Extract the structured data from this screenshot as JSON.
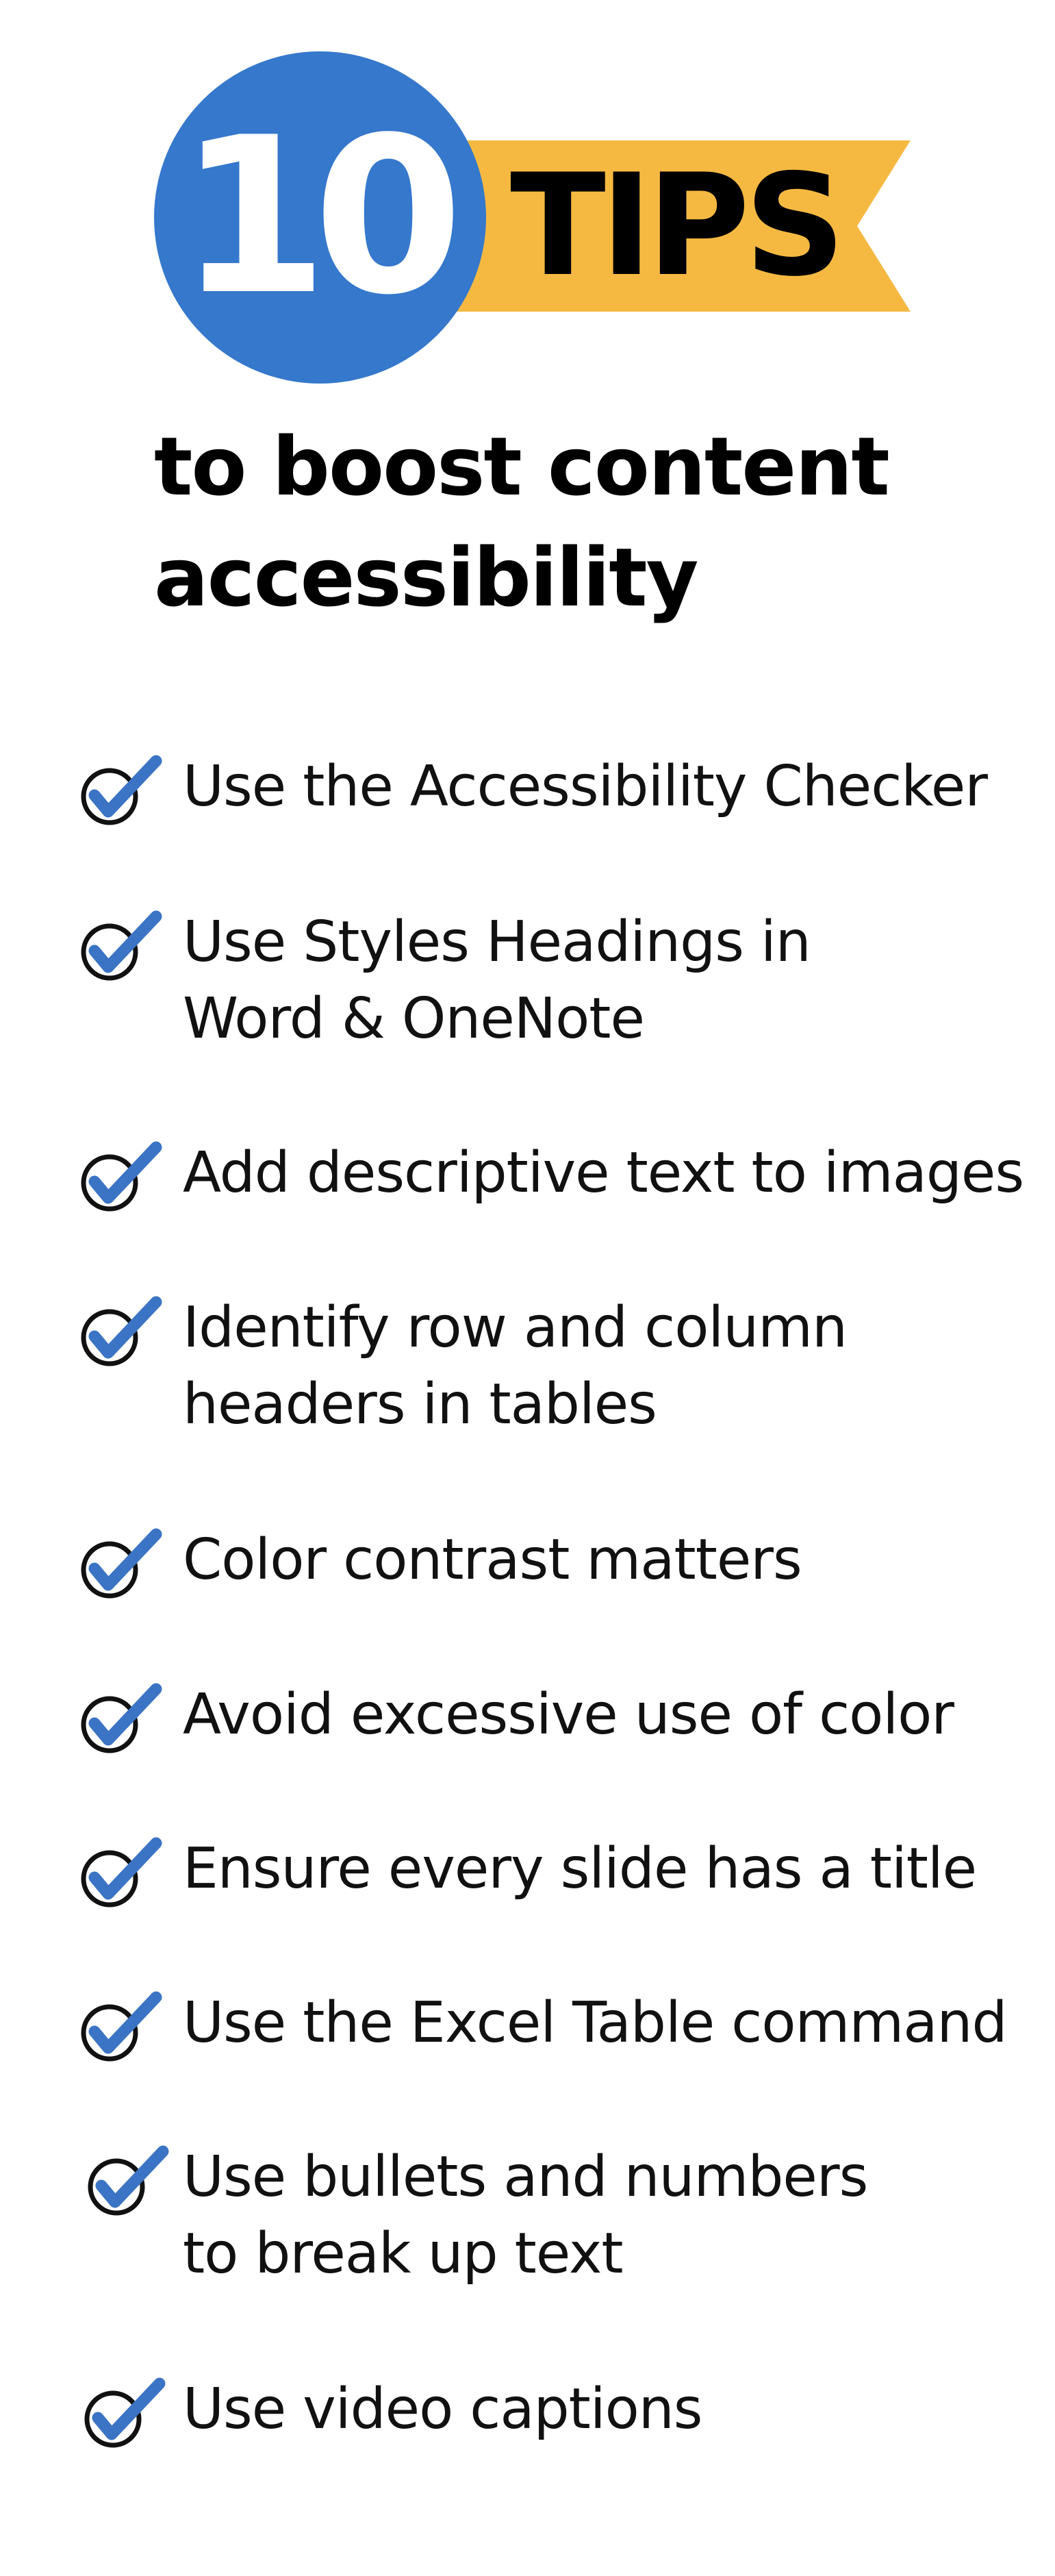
{
  "header": {
    "number": "10",
    "ribbon_label": "TIPS",
    "subtitle_lines": [
      "to boost content",
      "accessibility"
    ]
  },
  "colors": {
    "badge_blue": "#3578cc",
    "ribbon_gold": "#f5b942",
    "check_blue": "#3b74c4",
    "circle_stroke": "#111111"
  },
  "tips": [
    {
      "icon": "checkmark-circle-icon",
      "lines": [
        "Use the Accessibility Checker"
      ]
    },
    {
      "icon": "checkmark-circle-icon",
      "lines": [
        "Use Styles Headings in",
        "Word & OneNote"
      ]
    },
    {
      "icon": "checkmark-circle-icon",
      "lines": [
        "Add descriptive text to images"
      ]
    },
    {
      "icon": "checkmark-circle-icon",
      "lines": [
        "Identify row and column",
        "headers in tables"
      ]
    },
    {
      "icon": "checkmark-circle-icon",
      "lines": [
        "Color contrast matters"
      ]
    },
    {
      "icon": "checkmark-circle-icon",
      "lines": [
        "Avoid excessive use of color"
      ]
    },
    {
      "icon": "checkmark-circle-icon",
      "lines": [
        "Ensure every slide has a title"
      ]
    },
    {
      "icon": "checkmark-circle-icon",
      "lines": [
        "Use the Excel Table command"
      ]
    },
    {
      "icon": "checkmark-circle-icon",
      "lines": [
        "Use bullets and numbers",
        "to break up text"
      ]
    },
    {
      "icon": "checkmark-circle-icon",
      "lines": [
        "Use video captions"
      ]
    }
  ]
}
